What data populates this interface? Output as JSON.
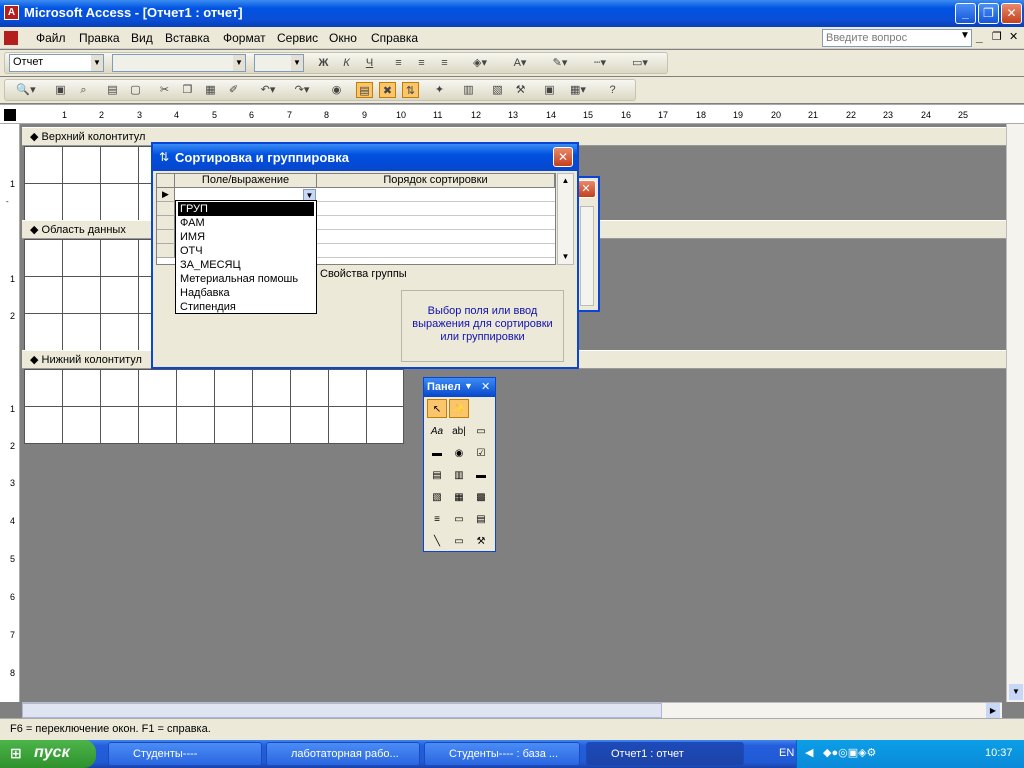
{
  "window": {
    "title": "Microsoft Access - [Отчет1 : отчет]",
    "minimize": "_",
    "restore": "❐",
    "close": "✕",
    "app_icon": "A"
  },
  "menu": {
    "items": [
      "Файл",
      "Правка",
      "Вид",
      "Вставка",
      "Формат",
      "Сервис",
      "Окно",
      "Справка"
    ],
    "help_placeholder": "Введите вопрос",
    "doc_min": "_",
    "doc_restore": "❐",
    "doc_close": "✕"
  },
  "formatting": {
    "object_combo": "Отчет",
    "bold": "Ж",
    "italic": "К",
    "underline": "Ч",
    "font_letter": "A"
  },
  "ruler": {
    "marks": [
      "1",
      "2",
      "3",
      "4",
      "5",
      "6",
      "7",
      "8",
      "9",
      "10",
      "11",
      "12",
      "13",
      "14",
      "15",
      "16",
      "17",
      "18",
      "19",
      "20",
      "21",
      "22",
      "23",
      "24",
      "25"
    ],
    "left_marks": [
      "1",
      "2",
      "1",
      "2",
      "1",
      "2",
      "3",
      "4",
      "5",
      "6",
      "7",
      "8"
    ]
  },
  "sections": {
    "header": "Верхний колонтитул",
    "detail": "Область данных",
    "footer": "Нижний колонтитул"
  },
  "dialog": {
    "title": "Сортировка и группировка",
    "col_field": "Поле/выражение",
    "col_order": "Порядок сортировки",
    "options": [
      "ГРУП",
      "ФАМ",
      "ИМЯ",
      "ОТЧ",
      "ЗА_МЕСЯЦ",
      "Метериальная помошь",
      "Надбавка",
      "Стипендия"
    ],
    "group_props": "Свойства группы",
    "description": "Выбор поля или ввод выражения для сортировки или группировки",
    "close": "✕"
  },
  "toolbox": {
    "title": "Панел",
    "close": "✕"
  },
  "status": {
    "text": "F6 = переключение окон.  F1 = справка."
  },
  "taskbar": {
    "start": "пуск",
    "tasks": [
      "Студенты----",
      "лаботаторная рабо...",
      "Студенты---- : база ...",
      "Отчет1 : отчет"
    ],
    "lang": "EN",
    "clock": "10:37"
  }
}
